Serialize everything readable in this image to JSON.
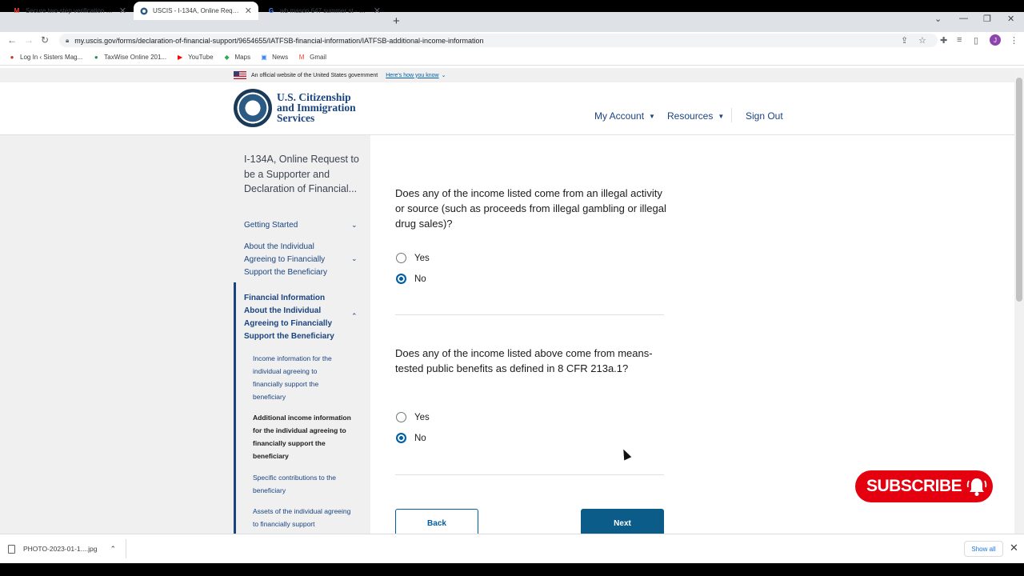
{
  "browser": {
    "tabs": [
      {
        "title": "Secure two-step verification noti",
        "favicon": "M",
        "favicon_color": "#ea4335"
      },
      {
        "title": "USCIS - I-134A, Online Request t",
        "favicon": "seal",
        "favicon_color": "#1a3a5a"
      },
      {
        "title": "wb mason 647 summer st - Goo",
        "favicon": "G",
        "favicon_color": "#4285f4"
      }
    ],
    "url": "my.uscis.gov/forms/declaration-of-financial-support/9654655/IATFSB-financial-information/IATFSB-additional-income-information",
    "profile_initial": "J",
    "bookmarks": [
      {
        "label": "Log In ‹ Sisters Mag...",
        "icon": "wordpress-icon"
      },
      {
        "label": "TaxWise Online 201...",
        "icon": "taxwise-icon"
      },
      {
        "label": "YouTube",
        "icon": "youtube-icon"
      },
      {
        "label": "Maps",
        "icon": "maps-icon"
      },
      {
        "label": "News",
        "icon": "news-icon"
      },
      {
        "label": "Gmail",
        "icon": "gmail-icon"
      }
    ]
  },
  "gov_banner": {
    "text": "An official website of the United States government",
    "link": "Here's how you know"
  },
  "header": {
    "brand_line1": "U.S. Citizenship",
    "brand_line2": "and Immigration",
    "brand_line3": "Services",
    "nav": [
      {
        "label": "My Account"
      },
      {
        "label": "Resources"
      },
      {
        "label": "Sign Out"
      }
    ]
  },
  "sidebar": {
    "form_title": "I-134A, Online Request to be a Supporter and Declaration of Financial...",
    "sections": [
      {
        "label": "Getting Started"
      },
      {
        "label": "About the Individual Agreeing to Financially Support the Beneficiary"
      }
    ],
    "active_section": "Financial Information About the Individual Agreeing to Financially Support the Beneficiary",
    "subitems": [
      {
        "label": "Income information for the individual agreeing to financially support the beneficiary"
      },
      {
        "label": "Additional income information for the individual agreeing to financially support the beneficiary"
      },
      {
        "label": "Specific contributions to the beneficiary"
      },
      {
        "label": "Assets of the individual agreeing to financially support"
      }
    ]
  },
  "main": {
    "q1": {
      "text": "Does any of the income listed come from an illegal activity or source (such as proceeds from illegal gambling or illegal drug sales)?",
      "options": [
        "Yes",
        "No"
      ],
      "selected": "No"
    },
    "q2": {
      "text": "Does any of the income listed above come from means-tested public benefits as defined in 8 CFR 213a.1?",
      "options": [
        "Yes",
        "No"
      ],
      "selected": "No"
    },
    "back_label": "Back",
    "next_label": "Next"
  },
  "overlay": {
    "subscribe_label": "SUBSCRIBE"
  },
  "downloads": {
    "file": "PHOTO-2023-01-1....jpg",
    "show_all": "Show all"
  },
  "colors": {
    "uscis_blue": "#1a4480",
    "primary_button": "#0c5c8a",
    "subscribe_red": "#e4000f"
  }
}
